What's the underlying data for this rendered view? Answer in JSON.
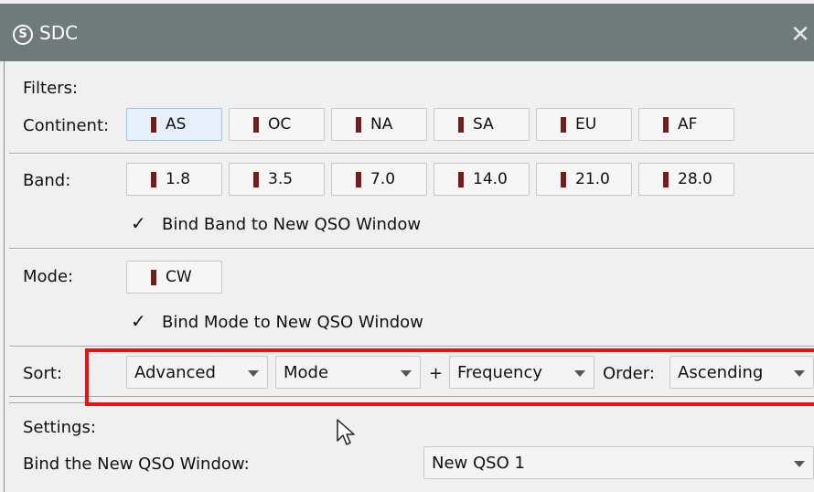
{
  "window": {
    "title": "SDC",
    "app_icon_letter": "S",
    "close_label": "✕"
  },
  "filters": {
    "heading": "Filters:",
    "continent": {
      "label": "Continent:",
      "buttons": [
        "AS",
        "OC",
        "NA",
        "SA",
        "EU",
        "AF"
      ],
      "selected": "AS"
    },
    "band": {
      "label": "Band:",
      "buttons": [
        "1.8",
        "3.5",
        "7.0",
        "14.0",
        "21.0",
        "28.0"
      ]
    },
    "bind_band": {
      "check": "✓",
      "label": "Bind Band to New QSO Window"
    },
    "mode": {
      "label": "Mode:",
      "buttons": [
        "CW"
      ]
    },
    "bind_mode": {
      "check": "✓",
      "label": "Bind Mode to New QSO Window"
    }
  },
  "sort": {
    "label": "Sort:",
    "primary": "Advanced",
    "secondary": "Mode",
    "plus": "+",
    "tertiary": "Frequency",
    "order_label": "Order:",
    "order": "Ascending"
  },
  "settings": {
    "heading": "Settings:",
    "bind_label": "Bind the New QSO Window:",
    "bind_value": "New QSO 1"
  },
  "colors": {
    "titlebar": "#6f7b7a",
    "marker": "#721c1c",
    "highlight": "#ee1111"
  }
}
